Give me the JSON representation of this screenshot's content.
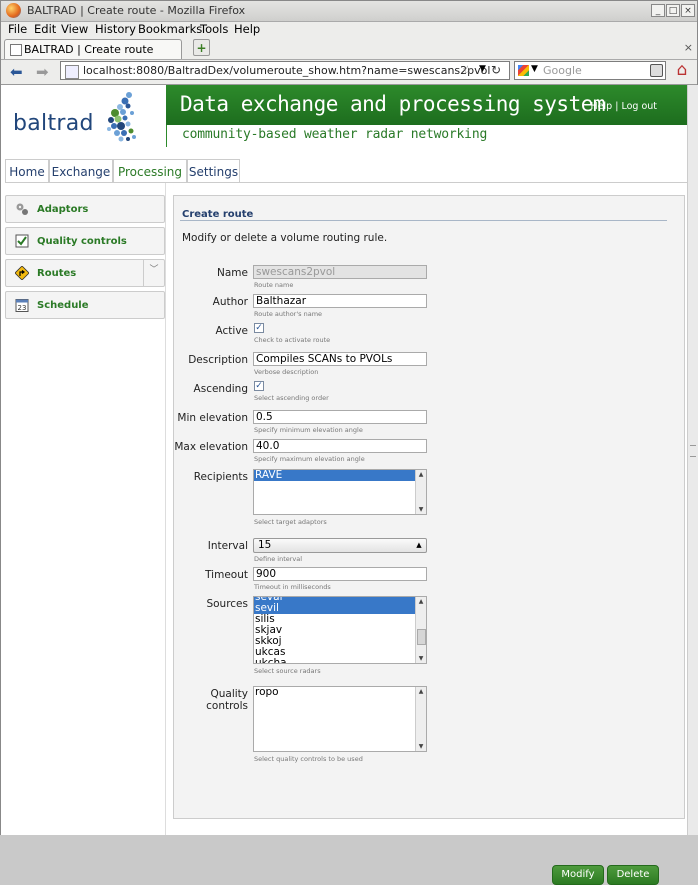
{
  "window": {
    "title": "BALTRAD | Create route - Mozilla Firefox",
    "controls": {
      "min": "_",
      "max": "□",
      "close": "×"
    }
  },
  "menubar": [
    "File",
    "Edit",
    "View",
    "History",
    "Bookmarks",
    "Tools",
    "Help"
  ],
  "tabs": [
    {
      "label": "BALTRAD | Create route"
    }
  ],
  "newtab_label": "+",
  "navbar": {
    "back": "⬅",
    "forward": "➡",
    "url": "localhost:8080/BaltradDex/volumeroute_show.htm?name=swescans2pvol",
    "star": "☆",
    "reload": "↻",
    "search_placeholder": "Google"
  },
  "site": {
    "logo": "baltrad",
    "banner_title": "Data exchange and processing system",
    "help": "Help",
    "logout": "Log out",
    "subtitle": "community-based weather radar networking"
  },
  "main_tabs": [
    "Home",
    "Exchange",
    "Processing",
    "Settings"
  ],
  "sidebar": [
    {
      "label": "Adaptors",
      "icon": "adaptors-icon"
    },
    {
      "label": "Quality controls",
      "icon": "quality-controls-icon"
    },
    {
      "label": "Routes",
      "icon": "routes-icon"
    },
    {
      "label": "Schedule",
      "icon": "schedule-icon"
    }
  ],
  "schedule_icon_text": "23",
  "form": {
    "heading": "Create route",
    "intro": "Modify or delete a volume routing rule.",
    "name": {
      "label": "Name",
      "value": "swescans2pvol",
      "hint": "Route name"
    },
    "author": {
      "label": "Author",
      "value": "Balthazar",
      "hint": "Route author's name"
    },
    "active": {
      "label": "Active",
      "checked": true,
      "hint": "Check to activate route"
    },
    "description": {
      "label": "Description",
      "value": "Compiles SCANs to PVOLs",
      "hint": "Verbose description"
    },
    "ascending": {
      "label": "Ascending",
      "checked": true,
      "hint": "Select ascending order"
    },
    "min_elevation": {
      "label": "Min elevation",
      "value": "0.5",
      "hint": "Specify minimum elevation angle"
    },
    "max_elevation": {
      "label": "Max elevation",
      "value": "40.0",
      "hint": "Specify maximum elevation angle"
    },
    "recipients": {
      "label": "Recipients",
      "options": [
        "RAVE"
      ],
      "selected": "RAVE",
      "hint": "Select target adaptors"
    },
    "interval": {
      "label": "Interval",
      "value": "15",
      "hint": "Define interval"
    },
    "timeout": {
      "label": "Timeout",
      "value": "900",
      "hint": "Timeout in milliseconds"
    },
    "sources": {
      "label": "Sources",
      "options": [
        "sevar",
        "sevil",
        "silis",
        "skjav",
        "skkoj",
        "ukcas",
        "ukcha"
      ],
      "selected": [
        "sevar",
        "sevil"
      ],
      "hint": "Select source radars"
    },
    "quality_controls": {
      "label": "Quality controls",
      "options": [
        "ropo"
      ],
      "hint": "Select quality controls to be used"
    },
    "modify_button": "Modify",
    "delete_button": "Delete"
  },
  "colors": {
    "banner_green": "#2d8a2b",
    "link_blue": "#243f6d",
    "selection": "#3878c8"
  }
}
